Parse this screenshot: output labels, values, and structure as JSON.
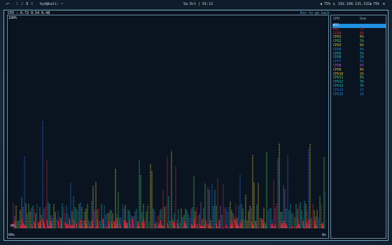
{
  "topbar": {
    "workspaces": [
      "1",
      "2",
      "3",
      "4"
    ],
    "active_workspace": "3",
    "window_title": "kyd@kali: ~",
    "datetime": "Sa Oct | 01:12",
    "volume": "75%",
    "ip": "192.168.131.132",
    "battery": "79%"
  },
  "terminal": {
    "title": "CPU — 0.72 0.54 0.48",
    "hint": "Esc to go back",
    "axis_top": "100%",
    "axis_bottom": "0%",
    "x_left": "60s",
    "x_right": "0s"
  },
  "cpu_list": {
    "header_name": "CPU",
    "header_use": "Use",
    "rows": [
      {
        "name": "All",
        "use": "",
        "color": "#ffffff"
      },
      {
        "name": "AVG",
        "use": "7%",
        "color": "#d92a3a"
      },
      {
        "name": "CPU0",
        "use": "8%",
        "color": "#d92a3a"
      },
      {
        "name": "CPU1",
        "use": "6%",
        "color": "#d6d044"
      },
      {
        "name": "CPU2",
        "use": "3%",
        "color": "#5fd45f"
      },
      {
        "name": "CPU3",
        "use": "6%",
        "color": "#d6d044"
      },
      {
        "name": "CPU4",
        "use": "6%",
        "color": "#2a8fd9"
      },
      {
        "name": "CPU5",
        "use": "3%",
        "color": "#2ac4c4"
      },
      {
        "name": "CPU6",
        "use": "2%",
        "color": "#2ac4c4"
      },
      {
        "name": "CPU7",
        "use": "6%",
        "color": "#2a6fd9"
      },
      {
        "name": "CPU8",
        "use": "6%",
        "color": "#b15fd6"
      },
      {
        "name": "CPU9",
        "use": "8%",
        "color": "#e0c040"
      },
      {
        "name": "CPU10",
        "use": "2%",
        "color": "#e0c040"
      },
      {
        "name": "CPU11",
        "use": "8%",
        "color": "#5fd45f"
      },
      {
        "name": "CPU12",
        "use": "3%",
        "color": "#2ac4c4"
      },
      {
        "name": "CPU13",
        "use": "3%",
        "color": "#2ac4c4"
      },
      {
        "name": "CPU14",
        "use": "2%",
        "color": "#2a6fd9"
      },
      {
        "name": "CPU15",
        "use": "2%",
        "color": "#2a8fd9"
      }
    ]
  }
}
